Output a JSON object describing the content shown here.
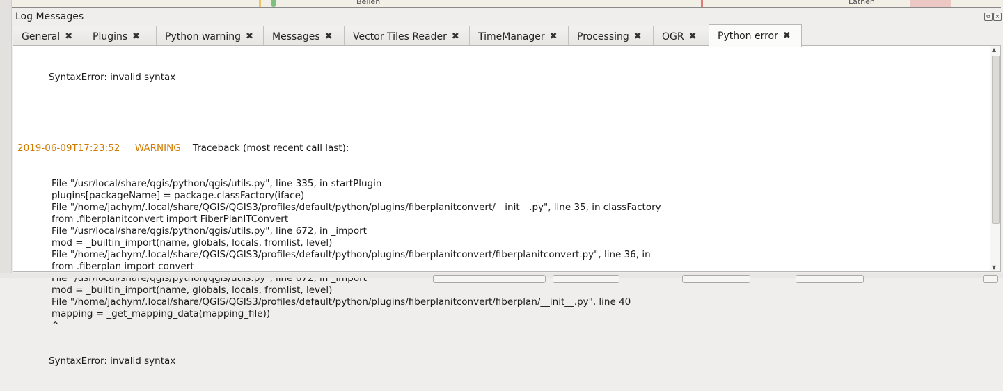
{
  "panel": {
    "title": "Log Messages"
  },
  "map": {
    "labels": [
      "Beilen",
      "Lathen"
    ]
  },
  "tabs": [
    {
      "label": "General",
      "active": false
    },
    {
      "label": "Plugins",
      "active": false
    },
    {
      "label": "Python warning",
      "active": false
    },
    {
      "label": "Messages",
      "active": false
    },
    {
      "label": "Vector Tiles Reader",
      "active": false
    },
    {
      "label": "TimeManager",
      "active": false
    },
    {
      "label": "Processing",
      "active": false
    },
    {
      "label": "OGR",
      "active": false
    },
    {
      "label": "Python error",
      "active": true
    }
  ],
  "tab_close_glyph": "✖",
  "log": {
    "timestamp": "2019-06-09T17:23:52",
    "level": "WARNING",
    "first_line": "SyntaxError: invalid syntax",
    "traceback_header": "Traceback (most recent call last):",
    "lines": [
      "File \"/usr/local/share/qgis/python/qgis/utils.py\", line 335, in startPlugin",
      "plugins[packageName] = package.classFactory(iface)",
      "File \"/home/jachym/.local/share/QGIS/QGIS3/profiles/default/python/plugins/fiberplanitconvert/__init__.py\", line 35, in classFactory",
      "from .fiberplanitconvert import FiberPlanITConvert",
      "File \"/usr/local/share/qgis/python/qgis/utils.py\", line 672, in _import",
      "mod = _builtin_import(name, globals, locals, fromlist, level)",
      "File \"/home/jachym/.local/share/QGIS/QGIS3/profiles/default/python/plugins/fiberplanitconvert/fiberplanitconvert.py\", line 36, in",
      "from .fiberplan import convert",
      "File \"/usr/local/share/qgis/python/qgis/utils.py\", line 672, in _import",
      "mod = _builtin_import(name, globals, locals, fromlist, level)",
      "File \"/home/jachym/.local/share/QGIS/QGIS3/profiles/default/python/plugins/fiberplanitconvert/fiberplan/__init__.py\", line 40",
      "mapping = _get_mapping_data(mapping_file))",
      "^"
    ],
    "last_line": "SyntaxError: invalid syntax"
  },
  "colors": {
    "warning": "#d07a00",
    "panel_bg": "#efeeec",
    "content_bg": "#ffffff"
  }
}
